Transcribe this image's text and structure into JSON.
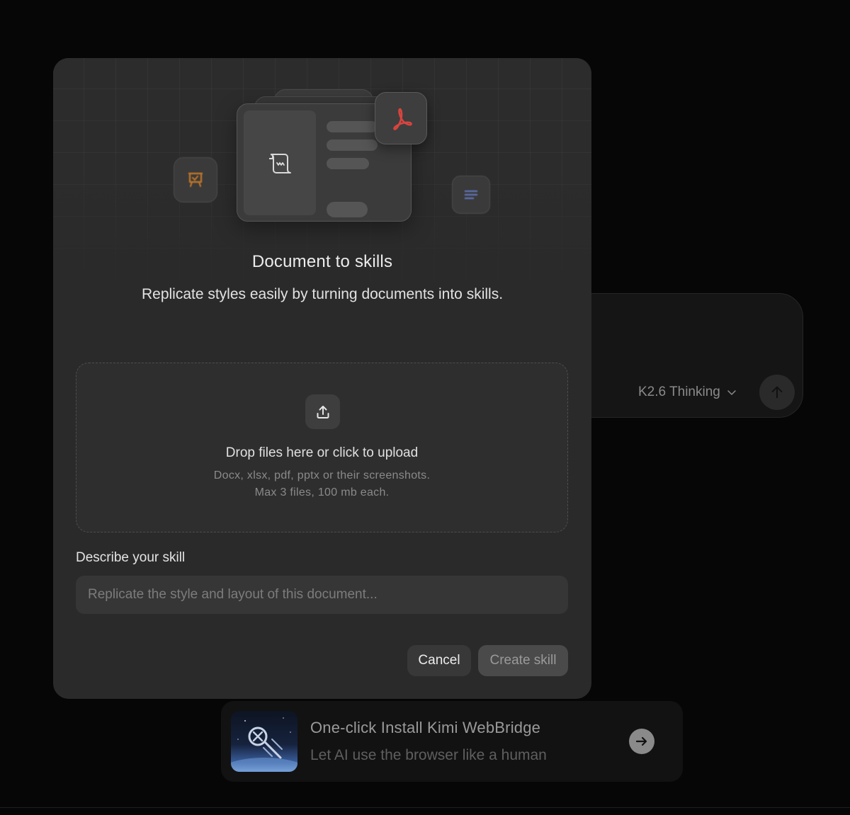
{
  "chat": {
    "model_label": "K2.6 Thinking"
  },
  "promo": {
    "title": "One-click Install Kimi WebBridge",
    "subtitle": "Let AI use the browser like a human"
  },
  "modal": {
    "title": "Document to skills",
    "subtitle": "Replicate styles easily by turning documents into skills.",
    "dropzone": {
      "title": "Drop files here or click to upload",
      "hint_formats": "Docx, xlsx, pdf, pptx or their screenshots.",
      "hint_limits": "Max 3 files, 100 mb each."
    },
    "describe": {
      "label": "Describe your skill",
      "value": "",
      "placeholder": "Replicate the style and layout of this document..."
    },
    "buttons": {
      "cancel": "Cancel",
      "create": "Create skill"
    }
  },
  "icons": {
    "hero_doc": "scroll-document-icon",
    "hero_pdf": "pdf-icon",
    "hero_left": "presentation-icon",
    "hero_right": "text-lines-icon",
    "upload": "upload-icon",
    "send": "arrow-up-icon",
    "model_dropdown": "chevron-down-icon",
    "promo_arrow": "arrow-right-icon"
  },
  "colors": {
    "pdf_red": "#d9443e",
    "presentation_orange": "#b8732a",
    "text_lines_blue": "#5b6fa8"
  }
}
